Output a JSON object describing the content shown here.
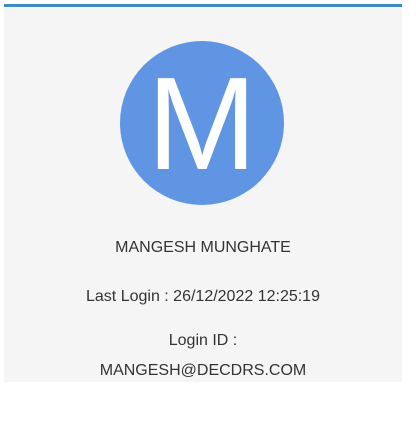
{
  "profile": {
    "avatar_letter": "M",
    "avatar_color": "#5f95e3",
    "name": "MANGESH MUNGHATE",
    "last_login": "Last Login : 26/12/2022 12:25:19",
    "login_id_label": "Login ID :",
    "login_id_value": "MANGESH@DECDRS.COM"
  },
  "colors": {
    "card_background": "#f5f5f5",
    "card_top_border": "#3c8dbc",
    "text": "#333333"
  }
}
